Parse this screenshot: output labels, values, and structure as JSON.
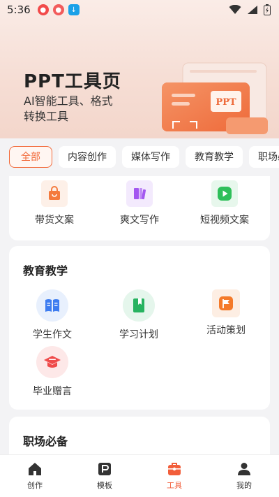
{
  "status": {
    "time": "5:36"
  },
  "hero": {
    "title": "PPT工具页",
    "subtitle": "AI智能工具、格式转换工具",
    "art_text": "PPT"
  },
  "chips": [
    "全部",
    "内容创作",
    "媒体写作",
    "教育教学",
    "职场必备"
  ],
  "section_top": {
    "items": [
      {
        "label": "带货文案",
        "icon": "shopping-bag-icon",
        "color": "#f47a3d"
      },
      {
        "label": "爽文写作",
        "icon": "book-icon",
        "color": "#a357f0"
      },
      {
        "label": "短视频文案",
        "icon": "play-icon",
        "color": "#2fbf5a"
      }
    ]
  },
  "section_edu": {
    "title": "教育教学",
    "items": [
      {
        "label": "学生作文",
        "icon": "open-book-icon",
        "color": "#3d7cf0"
      },
      {
        "label": "学习计划",
        "icon": "book-bookmark-icon",
        "color": "#27b360"
      },
      {
        "label": "活动策划",
        "icon": "flag-icon",
        "color": "#f47a2a"
      },
      {
        "label": "毕业赠言",
        "icon": "graduation-cap-icon",
        "color": "#ef4b4b"
      }
    ]
  },
  "section_work": {
    "title": "职场必备"
  },
  "tabs": [
    {
      "label": "创作",
      "icon": "home-icon"
    },
    {
      "label": "模板",
      "icon": "template-icon"
    },
    {
      "label": "工具",
      "icon": "toolbox-icon"
    },
    {
      "label": "我的",
      "icon": "user-icon"
    }
  ],
  "colors": {
    "accent": "#f26a3a"
  }
}
